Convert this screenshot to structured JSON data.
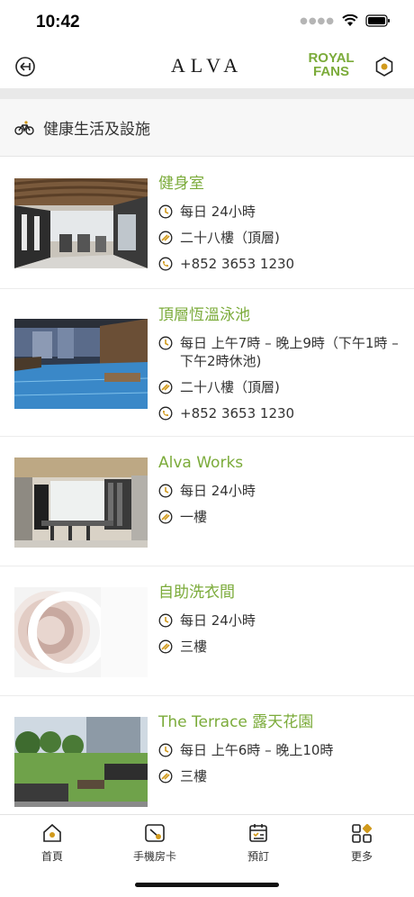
{
  "status": {
    "time": "10:42"
  },
  "header": {
    "brand": "ALVA",
    "royal_line1": "ROYAL",
    "royal_line2": "FANS"
  },
  "section": {
    "title": "健康生活及設施"
  },
  "facilities": [
    {
      "name": "健身室",
      "hours": "每日 24小時",
      "location": "二十八樓（頂層)",
      "phone": "+852 3653 1230"
    },
    {
      "name": "頂層恆溫泳池",
      "hours": "每日 上午7時 – 晚上9時（下午1時 – 下午2時休池)",
      "location": "二十八樓（頂層)",
      "phone": "+852 3653 1230"
    },
    {
      "name": "Alva Works",
      "hours": "每日 24小時",
      "location": "一樓"
    },
    {
      "name": "自助洗衣間",
      "hours": "每日 24小時",
      "location": "三樓"
    },
    {
      "name": "The Terrace 露天花園",
      "hours": "每日 上午6時 – 晚上10時",
      "location": "三樓"
    }
  ],
  "tabs": [
    {
      "label": "首頁",
      "icon": "home-icon"
    },
    {
      "label": "手機房卡",
      "icon": "room-key-icon"
    },
    {
      "label": "預訂",
      "icon": "booking-icon"
    },
    {
      "label": "更多",
      "icon": "more-grid-icon"
    }
  ],
  "colors": {
    "accent": "#7bab3a",
    "icon_amber": "#d19a1c"
  }
}
